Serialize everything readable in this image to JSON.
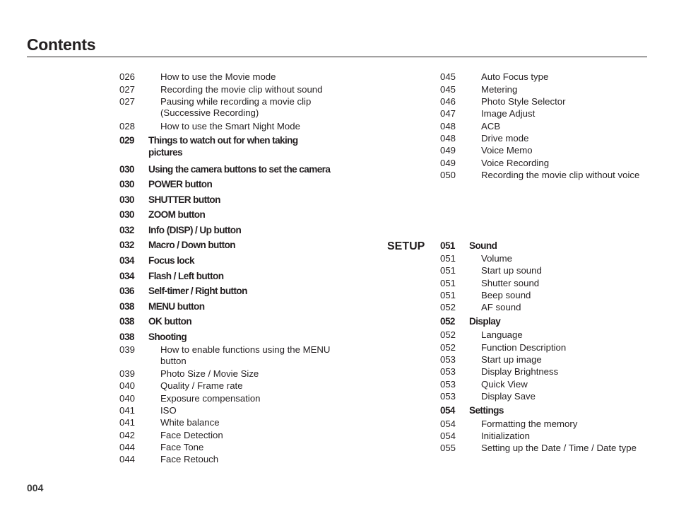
{
  "page": {
    "title": "Contents",
    "page_number": "004",
    "section_label": "SETUP"
  },
  "left_column": [
    {
      "page": "026",
      "text": "How to use the Movie mode",
      "level": "sub"
    },
    {
      "page": "027",
      "text": "Recording the movie clip without sound",
      "level": "sub"
    },
    {
      "page": "027",
      "text": "Pausing while recording a movie clip",
      "text2": "(Successive Recording)",
      "level": "sub"
    },
    {
      "page": "028",
      "text": "How to use the Smart Night Mode",
      "level": "sub"
    },
    {
      "page": "029",
      "text": "Things to watch out for when taking",
      "text2": "pictures",
      "level": "main"
    },
    {
      "page": "030",
      "text": "Using the camera buttons to set the camera",
      "level": "main"
    },
    {
      "page": "030",
      "text": "POWER button",
      "level": "main"
    },
    {
      "page": "030",
      "text": "SHUTTER button",
      "level": "main"
    },
    {
      "page": "030",
      "text": "ZOOM button",
      "level": "main"
    },
    {
      "page": "032",
      "text": "Info (DISP) / Up button",
      "level": "main"
    },
    {
      "page": "032",
      "text": "Macro / Down button",
      "level": "main"
    },
    {
      "page": "034",
      "text": "Focus lock",
      "level": "main"
    },
    {
      "page": "034",
      "text": "Flash / Left button",
      "level": "main"
    },
    {
      "page": "036",
      "text": "Self-timer / Right button",
      "level": "main"
    },
    {
      "page": "038",
      "text": "MENU button",
      "level": "main"
    },
    {
      "page": "038",
      "text": "OK button",
      "level": "main"
    },
    {
      "page": "038",
      "text": "Shooting",
      "level": "main"
    },
    {
      "page": "039",
      "text": "How to enable functions using the MENU",
      "text2": "button",
      "level": "sub"
    },
    {
      "page": "039",
      "text": "Photo Size / Movie Size",
      "level": "sub"
    },
    {
      "page": "040",
      "text": "Quality / Frame rate",
      "level": "sub"
    },
    {
      "page": "040",
      "text": "Exposure compensation",
      "level": "sub"
    },
    {
      "page": "041",
      "text": "ISO",
      "level": "sub"
    },
    {
      "page": "041",
      "text": "White balance",
      "level": "sub"
    },
    {
      "page": "042",
      "text": "Face Detection",
      "level": "sub"
    },
    {
      "page": "044",
      "text": "Face Tone",
      "level": "sub"
    },
    {
      "page": "044",
      "text": "Face Retouch",
      "level": "sub"
    }
  ],
  "right_column": [
    {
      "page": "045",
      "text": "Auto Focus type",
      "level": "sub"
    },
    {
      "page": "045",
      "text": "Metering",
      "level": "sub"
    },
    {
      "page": "046",
      "text": "Photo Style Selector",
      "level": "sub"
    },
    {
      "page": "047",
      "text": "Image Adjust",
      "level": "sub"
    },
    {
      "page": "048",
      "text": "ACB",
      "level": "sub"
    },
    {
      "page": "048",
      "text": "Drive mode",
      "level": "sub"
    },
    {
      "page": "049",
      "text": "Voice Memo",
      "level": "sub"
    },
    {
      "page": "049",
      "text": "Voice Recording",
      "level": "sub"
    },
    {
      "page": "050",
      "text": "Recording the movie clip without voice",
      "level": "sub"
    }
  ],
  "setup_column": [
    {
      "page": "051",
      "text": "Sound",
      "level": "main"
    },
    {
      "page": "051",
      "text": "Volume",
      "level": "sub"
    },
    {
      "page": "051",
      "text": "Start up sound",
      "level": "sub"
    },
    {
      "page": "051",
      "text": "Shutter sound",
      "level": "sub"
    },
    {
      "page": "051",
      "text": "Beep sound",
      "level": "sub"
    },
    {
      "page": "052",
      "text": "AF sound",
      "level": "sub"
    },
    {
      "page": "052",
      "text": "Display",
      "level": "main"
    },
    {
      "page": "052",
      "text": "Language",
      "level": "sub"
    },
    {
      "page": "052",
      "text": "Function Description",
      "level": "sub"
    },
    {
      "page": "053",
      "text": "Start up image",
      "level": "sub"
    },
    {
      "page": "053",
      "text": "Display Brightness",
      "level": "sub"
    },
    {
      "page": "053",
      "text": "Quick View",
      "level": "sub"
    },
    {
      "page": "053",
      "text": "Display Save",
      "level": "sub"
    },
    {
      "page": "054",
      "text": "Settings",
      "level": "main"
    },
    {
      "page": "054",
      "text": "Formatting the memory",
      "level": "sub"
    },
    {
      "page": "054",
      "text": "Initialization",
      "level": "sub"
    },
    {
      "page": "055",
      "text": "Setting up the Date / Time / Date type",
      "level": "sub"
    }
  ]
}
